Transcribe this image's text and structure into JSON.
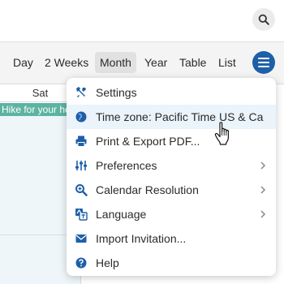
{
  "header": {
    "search_icon": "search-icon"
  },
  "toolbar": {
    "tabs": [
      {
        "label": "Day"
      },
      {
        "label": "2 Weeks"
      },
      {
        "label": "Month",
        "active": true
      },
      {
        "label": "Year"
      },
      {
        "label": "Table"
      },
      {
        "label": "List"
      }
    ],
    "menu_icon": "hamburger-icon"
  },
  "calendar": {
    "day_header": "Sat",
    "event_label": "Hike for your he"
  },
  "menu": {
    "items": [
      {
        "label": "Settings",
        "icon": "tools-icon",
        "has_submenu": false
      },
      {
        "label": "Time zone: Pacific Time US & Ca",
        "icon": "globe-icon",
        "has_submenu": false,
        "hovered": true
      },
      {
        "label": "Print & Export PDF...",
        "icon": "printer-icon",
        "has_submenu": false
      },
      {
        "label": "Preferences",
        "icon": "sliders-icon",
        "has_submenu": true
      },
      {
        "label": "Calendar Resolution",
        "icon": "zoom-icon",
        "has_submenu": true
      },
      {
        "label": "Language",
        "icon": "translate-icon",
        "has_submenu": true
      },
      {
        "label": "Import Invitation...",
        "icon": "envelope-icon",
        "has_submenu": false
      },
      {
        "label": "Help",
        "icon": "help-icon",
        "has_submenu": false
      }
    ]
  },
  "colors": {
    "accent": "#1e5fa8",
    "event": "#5db3a2",
    "hover": "#ebf3fb"
  }
}
